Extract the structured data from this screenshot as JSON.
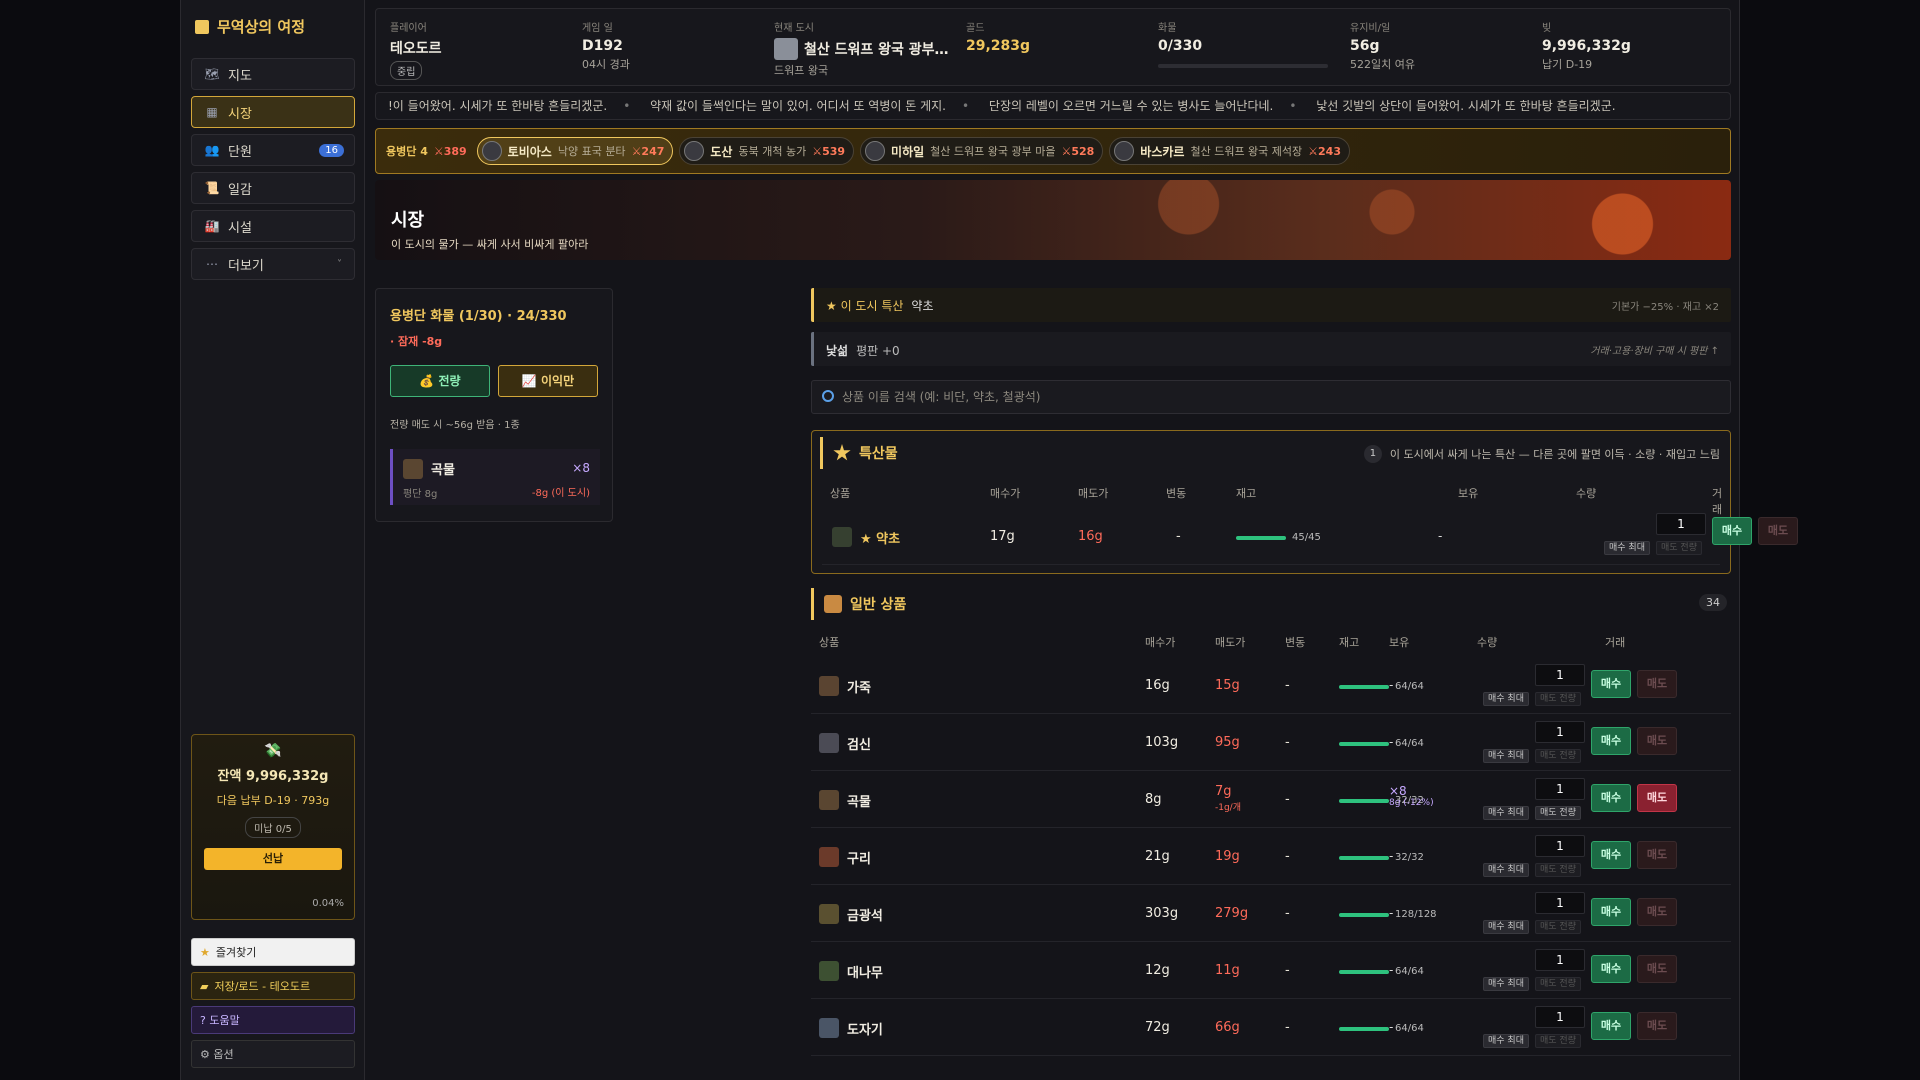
{
  "sidebar": {
    "title": "무역상의 여정",
    "items": [
      {
        "label": "지도",
        "icon": "map-icon"
      },
      {
        "label": "시장",
        "icon": "market-icon",
        "active": true
      },
      {
        "label": "단원",
        "icon": "crew-icon",
        "badge": "16"
      },
      {
        "label": "일감",
        "icon": "scroll-icon"
      },
      {
        "label": "시설",
        "icon": "building-icon"
      },
      {
        "label": "더보기",
        "icon": "more-icon"
      }
    ],
    "gold_card": {
      "balance": "잔액 9,996,332g",
      "next_due": "다음 납부 D-19 · 793g",
      "unpaid": "미납 0/5",
      "prepay": "선납",
      "percent": "0.04%"
    },
    "buttons": {
      "favorites": "즐겨찾기",
      "save_load": "저장/로드 - 테오도르",
      "help": "? 도움말",
      "options": "⚙ 옵션"
    }
  },
  "header": {
    "player_label": "플레이어",
    "player": "테오도르",
    "player_tag": "중립",
    "day_label": "게임 일",
    "day": "D192",
    "day_sub": "04시 경과",
    "city_label": "현재 도시",
    "city": "철산 드워프 왕국 광부…",
    "city_sub": "드워프 왕국",
    "gold_label": "골드",
    "gold": "29,283g",
    "cargo_label": "화물",
    "cargo": "0/330",
    "cargo_fill": 0,
    "upkeep_label": "유지비/일",
    "upkeep": "56g",
    "upkeep_sub": "522일치 여유",
    "debt_label": "빚",
    "debt": "9,996,332g",
    "debt_sub": "납기 D-19"
  },
  "ticker": [
    "!이 들어왔어. 시세가 또 한바탕 흔들리겠군.",
    "약재 값이 들썩인다는 말이 있어. 어디서 또 역병이 돈 게지.",
    "단장의 레벨이 오르면 거느릴 수 있는 병사도 늘어난다네.",
    "낯선 깃발의 상단이 들어왔어. 시세가 또 한바탕 흔들리겠군."
  ],
  "mercenary": {
    "label": "용병단 4",
    "total": "⚔389",
    "members": [
      {
        "name": "토비아스",
        "desc": "낙양 표국 분타",
        "cost": "⚔247",
        "selected": true
      },
      {
        "name": "도산",
        "desc": "동북 개척 농가",
        "cost": "⚔539"
      },
      {
        "name": "미하일",
        "desc": "철산 드워프 왕국 광부 마을",
        "cost": "⚔528"
      },
      {
        "name": "바스카르",
        "desc": "철산 드워프 왕국 제석장",
        "cost": "⚔243"
      }
    ]
  },
  "hero": {
    "title": "시장",
    "subtitle": "이 도시의 물가 — 싸게 사서 비싸게 팔아라"
  },
  "cargo_panel": {
    "title": "용병단 화물 (1/30) · 24/330",
    "warning": "· 잠재 -8g",
    "sell_all": "전량",
    "profit_only": "이익만",
    "note": "전량 매도 시 ~56g 받음 · 1종",
    "item": {
      "name": "곡물",
      "qty": "×8",
      "avg": "평단 8g",
      "loss": "-8g (이 도시)"
    }
  },
  "specialty_bar": {
    "label": "★ 이 도시 특산",
    "item": "약초",
    "right": "기본가 −25% · 재고 ×2"
  },
  "reputation_bar": {
    "label": "낯섦",
    "value": "평판 +0",
    "right": "거래·고용·장비 구매 시 평판 ↑"
  },
  "search": {
    "placeholder": "상품 이름 검색 (예: 비단, 약초, 철광석)"
  },
  "columns": {
    "product": "상품",
    "buy": "매수가",
    "sell": "매도가",
    "change": "변동",
    "stock": "재고",
    "hold": "보유",
    "qty": "수량",
    "trade": "거래"
  },
  "trade_labels": {
    "buy": "매수",
    "sell": "매도",
    "buy_max": "매수 최대",
    "sell_all": "매도 전량"
  },
  "specialty": {
    "title": "특산물",
    "count": "1",
    "note": "이 도시에서 싸게 나는 특산 — 다른 곳에 팔면 이득 · 소량 · 재입고 느림",
    "rows": [
      {
        "name": "★ 약초",
        "buy": "17g",
        "sell": "16g",
        "change": "-",
        "stock": "45/45",
        "stock_fill": 1,
        "hold": "-",
        "qty": "1"
      }
    ]
  },
  "general": {
    "title": "일반 상품",
    "count": "34",
    "rows": [
      {
        "name": "가죽",
        "buy": "16g",
        "sell": "15g",
        "change": "-",
        "stock": "64/64",
        "stock_fill": 1,
        "hold": "-",
        "qty": "1"
      },
      {
        "name": "검신",
        "buy": "103g",
        "sell": "95g",
        "change": "-",
        "stock": "64/64",
        "stock_fill": 1,
        "hold": "-",
        "qty": "1"
      },
      {
        "name": "곡물",
        "buy": "8g",
        "sell": "7g",
        "sell_sub": "-1g/개",
        "change": "-",
        "stock": "32/32",
        "stock_fill": 1,
        "hold": "×8",
        "hold_sub": "8g (-12%)",
        "qty": "1",
        "can_sell": true
      },
      {
        "name": "구리",
        "buy": "21g",
        "sell": "19g",
        "change": "-",
        "stock": "32/32",
        "stock_fill": 1,
        "hold": "-",
        "qty": "1"
      },
      {
        "name": "금광석",
        "buy": "303g",
        "sell": "279g",
        "change": "-",
        "stock": "128/128",
        "stock_fill": 1,
        "hold": "-",
        "qty": "1"
      },
      {
        "name": "대나무",
        "buy": "12g",
        "sell": "11g",
        "change": "-",
        "stock": "64/64",
        "stock_fill": 1,
        "hold": "-",
        "qty": "1"
      },
      {
        "name": "도자기",
        "buy": "72g",
        "sell": "66g",
        "change": "-",
        "stock": "64/64",
        "stock_fill": 1,
        "hold": "-",
        "qty": "1"
      }
    ]
  }
}
